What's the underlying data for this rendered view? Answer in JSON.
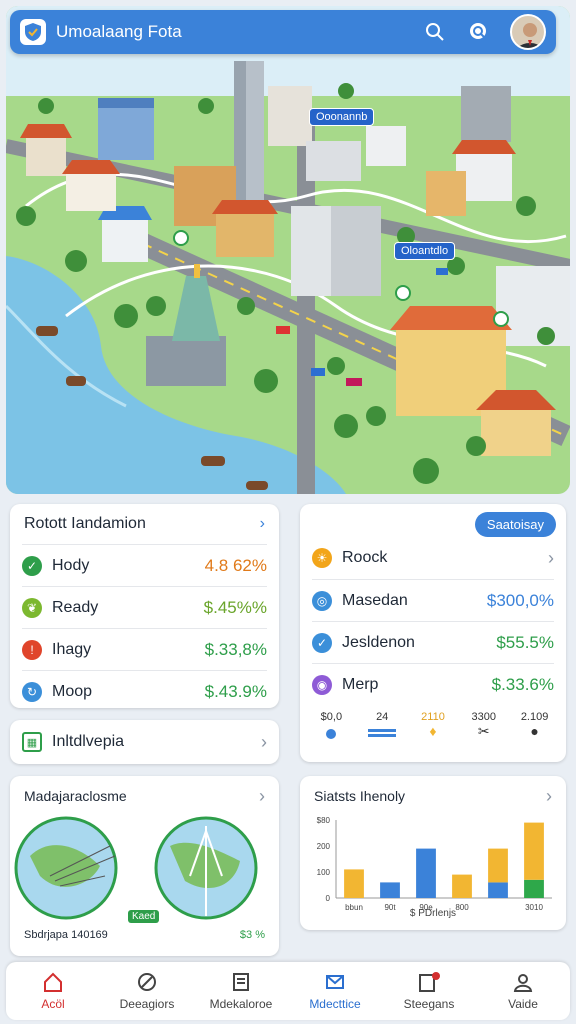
{
  "header": {
    "title": "Umoalaang Fota",
    "search_icon": "search-icon",
    "assistant_icon": "chat-search-icon"
  },
  "map": {
    "labels": [
      "Ooonannb",
      "Oloantdlo"
    ],
    "colors": {
      "water": "#7cc3e6",
      "grass": "#9fd07a",
      "road": "#8a8f96"
    }
  },
  "status_card": {
    "title": "Rotott Iandamion",
    "rows": [
      {
        "label": "Hody",
        "value": "4.8 62%",
        "icon": "check-icon",
        "color": "#2e9e4a",
        "value_color": "#e07a1a"
      },
      {
        "label": "Ready",
        "value": "$.45%%",
        "icon": "leaf-icon",
        "color": "#7cb82f",
        "value_color": "#6aa52b"
      },
      {
        "label": "Ihagy",
        "value": "$.33,8%",
        "icon": "alert-icon",
        "color": "#e0452b",
        "value_color": "#2e9e4a"
      },
      {
        "label": "Moop",
        "value": "$.43.9%",
        "icon": "refresh-icon",
        "color": "#3b8fd9",
        "value_color": "#2e9e4a"
      }
    ]
  },
  "right_card": {
    "badge": "Saatoisay",
    "rows": [
      {
        "label": "Roock",
        "value": "",
        "icon": "sun-icon",
        "color": "#f2a51a"
      },
      {
        "label": "Masedan",
        "value": "$300,0%",
        "icon": "target-icon",
        "color": "#3b8fd9",
        "value_color": "#3b82d9"
      },
      {
        "label": "Jesldenon",
        "value": "$55.5%",
        "icon": "check-icon",
        "color": "#3b8fd9",
        "value_color": "#2e9e4a"
      },
      {
        "label": "Merp",
        "value": "$.33.6%",
        "icon": "compass-icon",
        "color": "#8e5bd6",
        "value_color": "#2e9e4a"
      }
    ],
    "mini_stats": [
      "$0,0",
      "24",
      "2110",
      "3300",
      "2.109"
    ]
  },
  "insight_row": {
    "label": "Inltdlvepia"
  },
  "map_card": {
    "title": "Madajaraclosme",
    "footer_label": "Sbdrjapa 140169",
    "footer_value": "$3 %",
    "map_tag": "Kaed"
  },
  "stats_card": {
    "title": "Siatsts Ihenoly",
    "legend": "$ PDrlenjs",
    "chart_data": {
      "type": "bar",
      "categories": [
        "bbun",
        "90t",
        "90e",
        "800",
        "",
        "3010"
      ],
      "ytick_labels": [
        "$80",
        "200",
        "100",
        "0"
      ],
      "ylim": [
        0,
        300
      ],
      "series": [
        {
          "values": [
            110,
            60,
            190,
            90,
            60,
            70
          ],
          "color_list": [
            "#f2b632",
            "#3b82d9",
            "#3b82d9",
            "#f2b632",
            "#3b82d9",
            "#2ea84a"
          ]
        },
        {
          "values": [
            0,
            0,
            0,
            0,
            130,
            0
          ],
          "color_list": [
            "#f2b632",
            "#f2b632",
            "#f2b632",
            "#f2b632",
            "#f2b632",
            "#f2b632"
          ]
        },
        {
          "values": [
            0,
            0,
            0,
            0,
            0,
            220
          ],
          "color_list": [
            "#f2b632",
            "#f2b632",
            "#f2b632",
            "#f2b632",
            "#f2b632",
            "#f2b632"
          ]
        }
      ]
    }
  },
  "nav": [
    {
      "label": "Acöl",
      "icon": "home-icon",
      "active": true
    },
    {
      "label": "Deeagiors",
      "icon": "block-icon"
    },
    {
      "label": "Mdekaloroe",
      "icon": "document-icon"
    },
    {
      "label": "Mdecttice",
      "icon": "mail-icon"
    },
    {
      "label": "Steegans",
      "icon": "clipboard-icon"
    },
    {
      "label": "Vaide",
      "icon": "user-icon"
    }
  ]
}
